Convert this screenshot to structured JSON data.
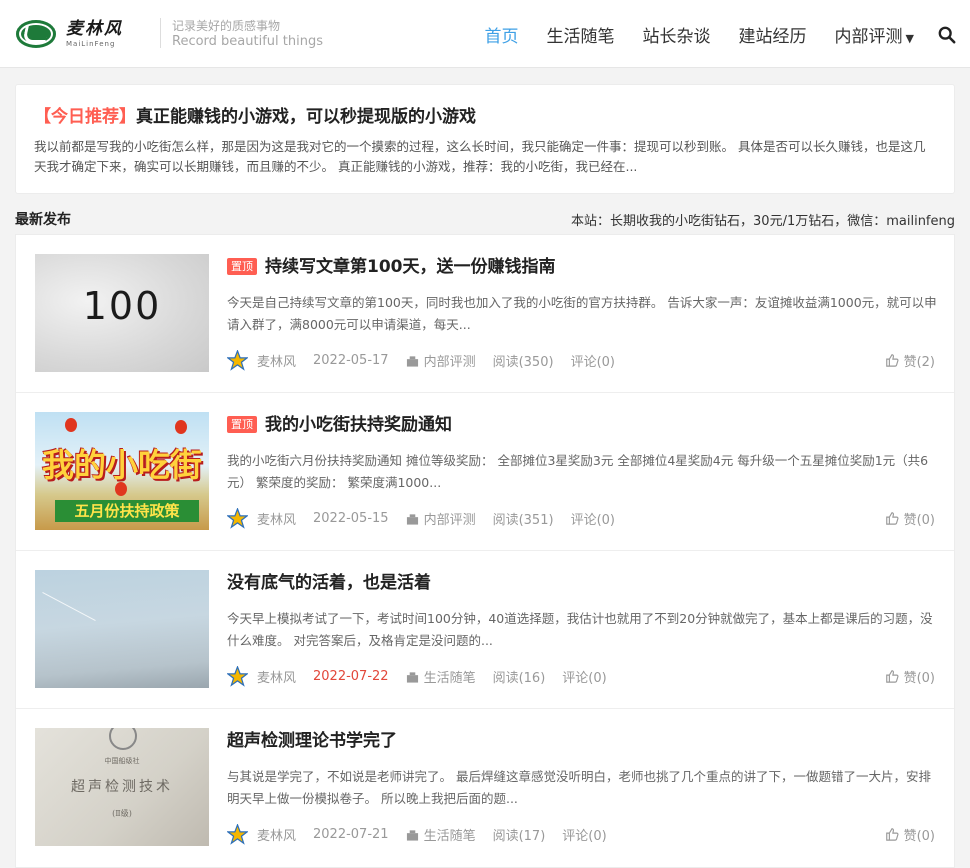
{
  "header": {
    "logo_cn": "麦林风",
    "logo_en": "MaiLinFeng",
    "slogan_cn": "记录美好的质感事物",
    "slogan_en": "Record beautiful things",
    "nav": [
      {
        "label": "首页"
      },
      {
        "label": "生活随笔"
      },
      {
        "label": "站长杂谈"
      },
      {
        "label": "建站经历"
      },
      {
        "label": "内部评测"
      }
    ]
  },
  "recommend": {
    "tag": "【今日推荐】",
    "title": "真正能赚钱的小游戏，可以秒提现版的小游戏",
    "desc": "我以前都是写我的小吃街怎么样，那是因为这是我对它的一个摸索的过程，这么长时间，我只能确定一件事：提现可以秒到账。 具体是否可以长久赚钱，也是这几天我才确定下来，确实可以长期赚钱，而且赚的不少。 真正能赚钱的小游戏，推荐：我的小吃街，我已经在..."
  },
  "section": {
    "title": "最新发布",
    "note": "本站：长期收我的小吃街钻石，30元/1万钻石，微信：mailinfeng"
  },
  "posts": [
    {
      "badge": "置顶",
      "title": "持续写文章第100天，送一份赚钱指南",
      "desc": "今天是自己持续写文章的第100天，同时我也加入了我的小吃街的官方扶持群。 告诉大家一声：友谊摊收益满1000元，就可以申请入群了，满8000元可以申请渠道，每天...",
      "author": "麦林风",
      "date": "2022-05-17",
      "category": "内部评测",
      "reads": "阅读(350)",
      "comments": "评论(0)",
      "likes": "赞(2)",
      "thumb_text": "100"
    },
    {
      "badge": "置顶",
      "title": "我的小吃街扶持奖励通知",
      "desc": "我的小吃街六月份扶持奖励通知 摊位等级奖励： 全部摊位3星奖励3元 全部摊位4星奖励4元 每升级一个五星摊位奖励1元（共6元） 繁荣度的奖励： 繁荣度满1000...",
      "author": "麦林风",
      "date": "2022-05-15",
      "category": "内部评测",
      "reads": "阅读(351)",
      "comments": "评论(0)",
      "likes": "赞(0)",
      "thumb_text": "我的小吃街",
      "thumb_sub": "五月份扶持政策"
    },
    {
      "badge": "",
      "title": "没有底气的活着，也是活着",
      "desc": "今天早上模拟考试了一下，考试时间100分钟，40道选择题，我估计也就用了不到20分钟就做完了，基本上都是课后的习题，没什么难度。 对完答案后，及格肯定是没问题的...",
      "author": "麦林风",
      "date": "2022-07-22",
      "category": "生活随笔",
      "reads": "阅读(16)",
      "comments": "评论(0)",
      "likes": "赞(0)"
    },
    {
      "badge": "",
      "title": "超声检测理论书学完了",
      "desc": "与其说是学完了，不如说是老师讲完了。 最后焊缝这章感觉没听明白，老师也挑了几个重点的讲了下，一做题错了一大片，安排明天早上做一份模拟卷子。 所以晚上我把后面的题...",
      "author": "麦林风",
      "date": "2022-07-21",
      "category": "生活随笔",
      "reads": "阅读(17)",
      "comments": "评论(0)",
      "likes": "赞(0)",
      "thumb_line1": "中国船级社",
      "thumb_line2": "超声检测技术",
      "thumb_line3": "(Ⅱ级)"
    }
  ],
  "colors": {
    "accent": "#3ea0e6",
    "badge": "#ff5e52",
    "date_highlight": "#e2473a"
  }
}
